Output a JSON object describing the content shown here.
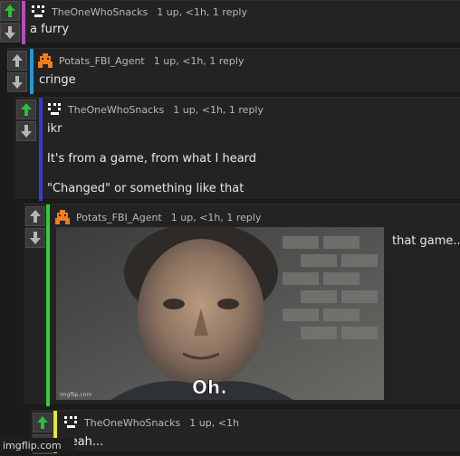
{
  "comments": [
    {
      "user": "TheOneWhoSnacks",
      "meta": "1 up, <1h, 1 reply",
      "lines": [
        "a furry"
      ],
      "bar_color": "#b64dbf"
    },
    {
      "user": "Potats_FBI_Agent",
      "meta": "1 up, <1h, 1 reply",
      "lines": [
        "cringe"
      ],
      "bar_color": "#1e9bd8"
    },
    {
      "user": "TheOneWhoSnacks",
      "meta": "1 up, <1h, 1 reply",
      "lines": [
        "ikr",
        "It's from a game, from what I heard",
        "\"Changed\" or something like that"
      ],
      "bar_color": "#3a3ad2"
    },
    {
      "user": "Potats_FBI_Agent",
      "meta": "1 up, <1h, 1 reply",
      "lines": [
        "that game..."
      ],
      "bar_color": "#2fd12f",
      "image_caption": "Oh.",
      "image_watermark": "imgflip.com"
    },
    {
      "user": "TheOneWhoSnacks",
      "meta": "1 up, <1h",
      "lines": [
        "yeah..."
      ],
      "bar_color": "#e8e82a"
    }
  ],
  "icons": {
    "upvote": "arrow-up-icon",
    "downvote": "arrow-down-icon",
    "avatar_snacks": "pixel-face-avatar",
    "avatar_potats": "orange-robot-avatar"
  },
  "colors": {
    "upvote_active": "#27c13a",
    "downvote": "#b5b5b5"
  },
  "footer": {
    "watermark": "imgflip.com"
  }
}
